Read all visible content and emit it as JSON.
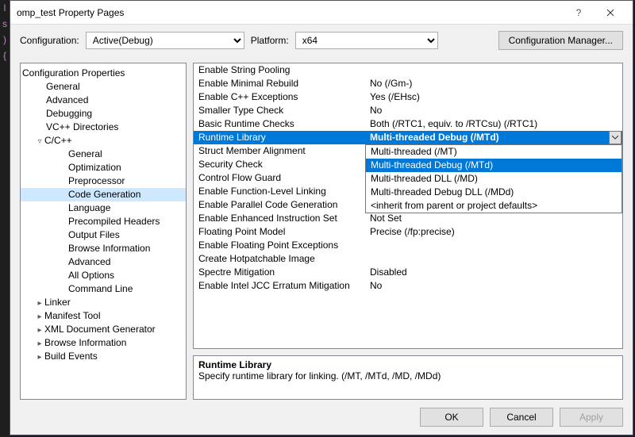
{
  "title": "omp_test Property Pages",
  "config": {
    "label": "Configuration:",
    "value": "Active(Debug)",
    "platform_label": "Platform:",
    "platform_value": "x64",
    "manager_btn": "Configuration Manager..."
  },
  "tree": [
    {
      "label": "Configuration Properties",
      "ind": 0,
      "caret": "▿"
    },
    {
      "label": "General",
      "ind": 1
    },
    {
      "label": "Advanced",
      "ind": 1
    },
    {
      "label": "Debugging",
      "ind": 1
    },
    {
      "label": "VC++ Directories",
      "ind": 1
    },
    {
      "label": "C/C++",
      "ind": 1,
      "caret": "▿"
    },
    {
      "label": "General",
      "ind": 2
    },
    {
      "label": "Optimization",
      "ind": 2
    },
    {
      "label": "Preprocessor",
      "ind": 2
    },
    {
      "label": "Code Generation",
      "ind": 2,
      "sel": true
    },
    {
      "label": "Language",
      "ind": 2
    },
    {
      "label": "Precompiled Headers",
      "ind": 2
    },
    {
      "label": "Output Files",
      "ind": 2
    },
    {
      "label": "Browse Information",
      "ind": 2
    },
    {
      "label": "Advanced",
      "ind": 2
    },
    {
      "label": "All Options",
      "ind": 2
    },
    {
      "label": "Command Line",
      "ind": 2
    },
    {
      "label": "Linker",
      "ind": 1,
      "caret": "▸"
    },
    {
      "label": "Manifest Tool",
      "ind": 1,
      "caret": "▸"
    },
    {
      "label": "XML Document Generator",
      "ind": 1,
      "caret": "▸"
    },
    {
      "label": "Browse Information",
      "ind": 1,
      "caret": "▸"
    },
    {
      "label": "Build Events",
      "ind": 1,
      "caret": "▸"
    }
  ],
  "props": [
    {
      "name": "Enable String Pooling",
      "val": ""
    },
    {
      "name": "Enable Minimal Rebuild",
      "val": "No (/Gm-)"
    },
    {
      "name": "Enable C++ Exceptions",
      "val": "Yes (/EHsc)"
    },
    {
      "name": "Smaller Type Check",
      "val": "No"
    },
    {
      "name": "Basic Runtime Checks",
      "val": "Both (/RTC1, equiv. to /RTCsu) (/RTC1)"
    },
    {
      "name": "Runtime Library",
      "val": "Multi-threaded Debug (/MTd)",
      "sel": true
    },
    {
      "name": "Struct Member Alignment",
      "val": ""
    },
    {
      "name": "Security Check",
      "val": ""
    },
    {
      "name": "Control Flow Guard",
      "val": ""
    },
    {
      "name": "Enable Function-Level Linking",
      "val": ""
    },
    {
      "name": "Enable Parallel Code Generation",
      "val": ""
    },
    {
      "name": "Enable Enhanced Instruction Set",
      "val": "Not Set"
    },
    {
      "name": "Floating Point Model",
      "val": "Precise (/fp:precise)"
    },
    {
      "name": "Enable Floating Point Exceptions",
      "val": ""
    },
    {
      "name": "Create Hotpatchable Image",
      "val": ""
    },
    {
      "name": "Spectre Mitigation",
      "val": "Disabled"
    },
    {
      "name": "Enable Intel JCC Erratum Mitigation",
      "val": "No"
    }
  ],
  "dropdown": {
    "top_row": 6,
    "items": [
      "Multi-threaded (/MT)",
      "Multi-threaded Debug (/MTd)",
      "Multi-threaded DLL (/MD)",
      "Multi-threaded Debug DLL (/MDd)",
      "<inherit from parent or project defaults>"
    ],
    "sel": 1
  },
  "desc": {
    "title": "Runtime Library",
    "text": "Specify runtime library for linking.     (/MT, /MTd, /MD, /MDd)"
  },
  "buttons": {
    "ok": "OK",
    "cancel": "Cancel",
    "apply": "Apply"
  }
}
